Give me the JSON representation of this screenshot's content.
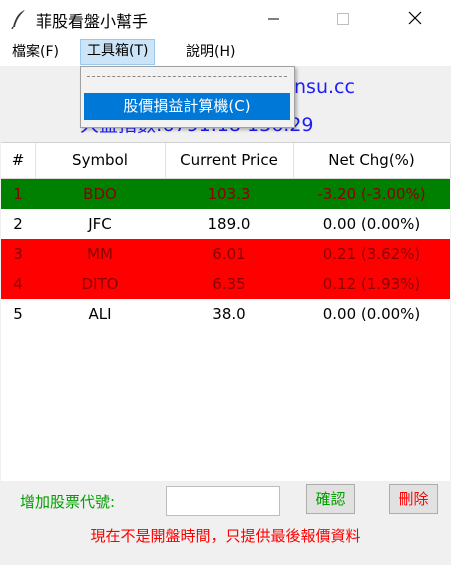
{
  "window": {
    "title": "菲股看盤小幫手"
  },
  "menu": {
    "file": "檔案(F)",
    "tools": "工具箱(T)",
    "help": "說明(H)"
  },
  "dropdown": {
    "item": "股價損益計算機(C)"
  },
  "info": {
    "site": "nsu.cc",
    "index": "大盤指數:6791.18  136.29"
  },
  "table": {
    "headers": [
      "#",
      "Symbol",
      "Current Price",
      "Net Chg(%)"
    ],
    "rows": [
      {
        "num": "1",
        "symbol": "BDO",
        "price": "103.3",
        "chg": "-3.20 (-3.00%)",
        "bg": "#008000"
      },
      {
        "num": "2",
        "symbol": "JFC",
        "price": "189.0",
        "chg": "0.00 (0.00%)",
        "bg": "#ffffff"
      },
      {
        "num": "3",
        "symbol": "MM",
        "price": "6.01",
        "chg": "0.21 (3.62%)",
        "bg": "#ff0000"
      },
      {
        "num": "4",
        "symbol": "DITO",
        "price": "6.35",
        "chg": "0.12 (1.93%)",
        "bg": "#ff0000"
      },
      {
        "num": "5",
        "symbol": "ALI",
        "price": "38.0",
        "chg": "0.00 (0.00%)",
        "bg": "#ffffff"
      }
    ]
  },
  "bottom": {
    "add_label": "增加股票代號:",
    "input_value": "",
    "ok_label": "確認",
    "delete_label": "刪除",
    "notice": "現在不是開盤時間，只提供最後報價資料"
  },
  "colors": {
    "up": "#ff0000",
    "down": "#008000",
    "highlight_text": "#8b0000",
    "info_text": "#1c1cff"
  }
}
